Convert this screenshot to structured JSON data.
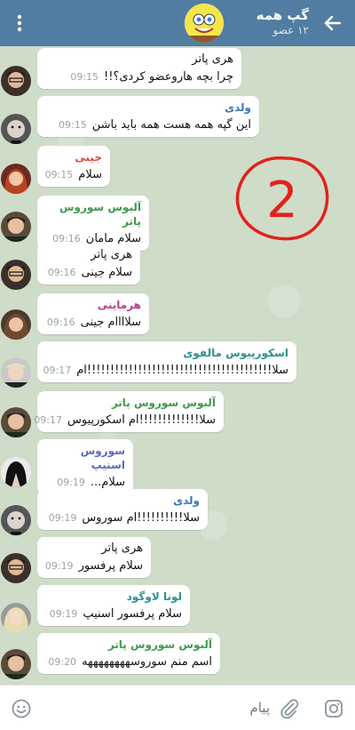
{
  "header": {
    "title": "گپ همه",
    "subtitle": "۱۲ عضو"
  },
  "colors": {
    "header_bg": "#517da2",
    "name_blue": "#3a77b5",
    "name_red": "#d8503e",
    "name_green": "#3f9a4b",
    "name_pink": "#c0398d",
    "name_teal": "#2d8f8f",
    "name_purple": "#5a6bb8",
    "annotation_red": "#e2211c"
  },
  "annotation": {
    "text": "2"
  },
  "messages": [
    {
      "sender": "هری پاتر",
      "text": "چرا بچه هاروعضو کردی؟!!",
      "time": "09:15"
    },
    {
      "sender": "ولدی",
      "text": "این گپه همه هست همه باید باشن",
      "time": "09:15"
    },
    {
      "sender": "جینی",
      "text": "سلام",
      "time": "09:15"
    },
    {
      "sender": "آلبوس سوروس پاتر",
      "text": "سلام مامان",
      "time": "09:16"
    },
    {
      "sender": "هری پاتر",
      "text": "سلام جینی",
      "time": "09:16"
    },
    {
      "sender": "هرماینی",
      "text": "سلاااام جینی",
      "time": "09:16"
    },
    {
      "sender": "اسکورپیوس مالفوی",
      "text": "سلا!!!!!!!!!!!!!!!!!!!!!!!!!!!!!!!!!!!!!!!!ام",
      "time": "09:17"
    },
    {
      "sender": "آلبوس سوروس پاتر",
      "text": "سلا!!!!!!!!!!!!!ام اسکورپیوس",
      "time": "09:17"
    },
    {
      "sender": "سوروس اسنیپ",
      "text": "سلام...",
      "time": "09:19"
    },
    {
      "sender": "ولدی",
      "text": "سلا!!!!!!!!!!ام سوروس",
      "time": "09:19"
    },
    {
      "sender": "هری پاتر",
      "text": "سلام پرفسور",
      "time": "09:19"
    },
    {
      "sender": "لونا لاوگود",
      "text": "سلام پرفسور اسنیپ",
      "time": "09:19"
    },
    {
      "sender": "آلبوس سوروس پاتر",
      "text": "اسم منم سوروسههههههههه",
      "time": "09:20"
    }
  ],
  "input": {
    "placeholder": "پیام"
  }
}
